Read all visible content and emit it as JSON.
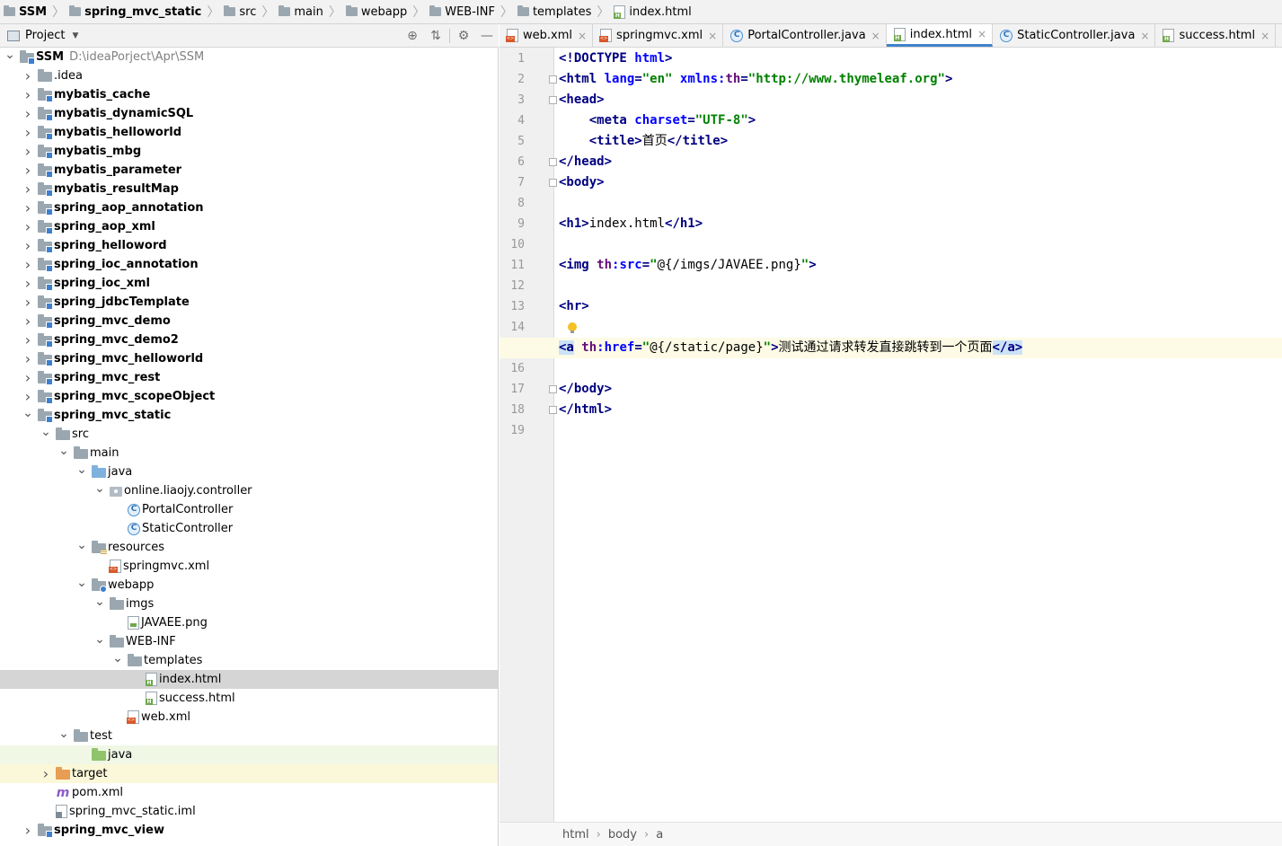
{
  "breadcrumb": [
    {
      "label": "SSM",
      "bold": true
    },
    {
      "label": "spring_mvc_static",
      "bold": true
    },
    {
      "label": "src",
      "bold": false
    },
    {
      "label": "main",
      "bold": false
    },
    {
      "label": "webapp",
      "bold": false
    },
    {
      "label": "WEB-INF",
      "bold": false
    },
    {
      "label": "templates",
      "bold": false
    },
    {
      "label": "index.html",
      "bold": false
    }
  ],
  "project_panel": {
    "title": "Project",
    "tools": [
      "locate-icon",
      "collapse-all-icon",
      "settings-icon",
      "hide-icon"
    ]
  },
  "tree": [
    {
      "label": "SSM",
      "path": "D:\\ideaPorject\\Apr\\SSM",
      "bold": true,
      "depth": 0,
      "arrow": "open",
      "icon": "module"
    },
    {
      "label": ".idea",
      "depth": 1,
      "arrow": "closed",
      "icon": "folder"
    },
    {
      "label": "mybatis_cache",
      "bold": true,
      "depth": 1,
      "arrow": "closed",
      "icon": "module"
    },
    {
      "label": "mybatis_dynamicSQL",
      "bold": true,
      "depth": 1,
      "arrow": "closed",
      "icon": "module"
    },
    {
      "label": "mybatis_helloworld",
      "bold": true,
      "depth": 1,
      "arrow": "closed",
      "icon": "module"
    },
    {
      "label": "mybatis_mbg",
      "bold": true,
      "depth": 1,
      "arrow": "closed",
      "icon": "module"
    },
    {
      "label": "mybatis_parameter",
      "bold": true,
      "depth": 1,
      "arrow": "closed",
      "icon": "module"
    },
    {
      "label": "mybatis_resultMap",
      "bold": true,
      "depth": 1,
      "arrow": "closed",
      "icon": "module"
    },
    {
      "label": "spring_aop_annotation",
      "bold": true,
      "depth": 1,
      "arrow": "closed",
      "icon": "module"
    },
    {
      "label": "spring_aop_xml",
      "bold": true,
      "depth": 1,
      "arrow": "closed",
      "icon": "module"
    },
    {
      "label": "spring_helloword",
      "bold": true,
      "depth": 1,
      "arrow": "closed",
      "icon": "module"
    },
    {
      "label": "spring_ioc_annotation",
      "bold": true,
      "depth": 1,
      "arrow": "closed",
      "icon": "module"
    },
    {
      "label": "spring_ioc_xml",
      "bold": true,
      "depth": 1,
      "arrow": "closed",
      "icon": "module"
    },
    {
      "label": "spring_jdbcTemplate",
      "bold": true,
      "depth": 1,
      "arrow": "closed",
      "icon": "module"
    },
    {
      "label": "spring_mvc_demo",
      "bold": true,
      "depth": 1,
      "arrow": "closed",
      "icon": "module"
    },
    {
      "label": "spring_mvc_demo2",
      "bold": true,
      "depth": 1,
      "arrow": "closed",
      "icon": "module"
    },
    {
      "label": "spring_mvc_helloworld",
      "bold": true,
      "depth": 1,
      "arrow": "closed",
      "icon": "module"
    },
    {
      "label": "spring_mvc_rest",
      "bold": true,
      "depth": 1,
      "arrow": "closed",
      "icon": "module"
    },
    {
      "label": "spring_mvc_scopeObject",
      "bold": true,
      "depth": 1,
      "arrow": "closed",
      "icon": "module"
    },
    {
      "label": "spring_mvc_static",
      "bold": true,
      "depth": 1,
      "arrow": "open",
      "icon": "module"
    },
    {
      "label": "src",
      "depth": 2,
      "arrow": "open",
      "icon": "folder"
    },
    {
      "label": "main",
      "depth": 3,
      "arrow": "open",
      "icon": "folder"
    },
    {
      "label": "java",
      "depth": 4,
      "arrow": "open",
      "icon": "src"
    },
    {
      "label": "online.liaojy.controller",
      "depth": 5,
      "arrow": "open",
      "icon": "pkg"
    },
    {
      "label": "PortalController",
      "depth": 6,
      "arrow": "none",
      "icon": "class"
    },
    {
      "label": "StaticController",
      "depth": 6,
      "arrow": "none",
      "icon": "class"
    },
    {
      "label": "resources",
      "depth": 4,
      "arrow": "open",
      "icon": "res"
    },
    {
      "label": "springmvc.xml",
      "depth": 5,
      "arrow": "none",
      "icon": "xml"
    },
    {
      "label": "webapp",
      "depth": 4,
      "arrow": "open",
      "icon": "web"
    },
    {
      "label": "imgs",
      "depth": 5,
      "arrow": "open",
      "icon": "folder"
    },
    {
      "label": "JAVAEE.png",
      "depth": 6,
      "arrow": "none",
      "icon": "img"
    },
    {
      "label": "WEB-INF",
      "depth": 5,
      "arrow": "open",
      "icon": "folder"
    },
    {
      "label": "templates",
      "depth": 6,
      "arrow": "open",
      "icon": "folder"
    },
    {
      "label": "index.html",
      "depth": 7,
      "arrow": "none",
      "icon": "html",
      "selected": true
    },
    {
      "label": "success.html",
      "depth": 7,
      "arrow": "none",
      "icon": "html"
    },
    {
      "label": "web.xml",
      "depth": 6,
      "arrow": "none",
      "icon": "xml"
    },
    {
      "label": "test",
      "depth": 3,
      "arrow": "open",
      "icon": "folder"
    },
    {
      "label": "java",
      "depth": 4,
      "arrow": "none",
      "icon": "test",
      "highlight": "test"
    },
    {
      "label": "target",
      "depth": 2,
      "arrow": "closed",
      "icon": "target",
      "highlight": "target"
    },
    {
      "label": "pom.xml",
      "depth": 2,
      "arrow": "none",
      "icon": "maven"
    },
    {
      "label": "spring_mvc_static.iml",
      "depth": 2,
      "arrow": "none",
      "icon": "iml"
    },
    {
      "label": "spring_mvc_view",
      "bold": true,
      "depth": 1,
      "arrow": "closed",
      "icon": "module"
    }
  ],
  "tabs": [
    {
      "label": "web.xml",
      "icon": "xml"
    },
    {
      "label": "springmvc.xml",
      "icon": "xml"
    },
    {
      "label": "PortalController.java",
      "icon": "class"
    },
    {
      "label": "index.html",
      "icon": "html",
      "active": true
    },
    {
      "label": "StaticController.java",
      "icon": "class"
    },
    {
      "label": "success.html",
      "icon": "html"
    }
  ],
  "editor": {
    "caret_line": 15,
    "lines": [
      [
        [
          "t",
          "<!DOCTYPE "
        ],
        [
          "a",
          "html"
        ],
        [
          "t",
          ">"
        ]
      ],
      [
        [
          "t",
          "<"
        ],
        [
          "t",
          "html"
        ],
        [
          "a",
          " lang"
        ],
        [
          "t",
          "="
        ],
        [
          "s",
          "\"en\""
        ],
        [
          "a",
          " xmlns:"
        ],
        [
          "n",
          "th"
        ],
        [
          "t",
          "="
        ],
        [
          "s",
          "\"http://www.thymeleaf.org\""
        ],
        [
          "t",
          ">"
        ]
      ],
      [
        [
          "t",
          "<head>"
        ]
      ],
      [
        [
          "p",
          "    "
        ],
        [
          "t",
          "<meta "
        ],
        [
          "a",
          "charset"
        ],
        [
          "t",
          "="
        ],
        [
          "s",
          "\"UTF-8\""
        ],
        [
          "t",
          ">"
        ]
      ],
      [
        [
          "p",
          "    "
        ],
        [
          "t",
          "<title>"
        ],
        [
          "p",
          "首页"
        ],
        [
          "t",
          "</title>"
        ]
      ],
      [
        [
          "t",
          "</head>"
        ]
      ],
      [
        [
          "t",
          "<body>"
        ]
      ],
      [],
      [
        [
          "t",
          "<h1>"
        ],
        [
          "p",
          "index.html"
        ],
        [
          "t",
          "</h1>"
        ]
      ],
      [],
      [
        [
          "t",
          "<img "
        ],
        [
          "n",
          "th"
        ],
        [
          "a",
          ":src"
        ],
        [
          "t",
          "="
        ],
        [
          "s",
          "\""
        ],
        [
          "p",
          "@{/imgs/JAVAEE.png}"
        ],
        [
          "s",
          "\""
        ],
        [
          "t",
          ">"
        ]
      ],
      [],
      [
        [
          "t",
          "<hr>"
        ]
      ],
      [],
      [
        [
          "m",
          "<a"
        ],
        [
          "p",
          " "
        ],
        [
          "n",
          "th"
        ],
        [
          "a",
          ":href"
        ],
        [
          "t",
          "="
        ],
        [
          "s",
          "\""
        ],
        [
          "p",
          "@{/static/page}"
        ],
        [
          "s",
          "\""
        ],
        [
          "t",
          ">"
        ],
        [
          "p",
          "测试通过请求转发直接跳转到一个页面"
        ],
        [
          "m",
          "</a>"
        ]
      ],
      [],
      [
        [
          "t",
          "</body>"
        ]
      ],
      [
        [
          "t",
          "</html>"
        ]
      ],
      []
    ]
  },
  "editor_breadcrumb": [
    "html",
    "body",
    "a"
  ]
}
